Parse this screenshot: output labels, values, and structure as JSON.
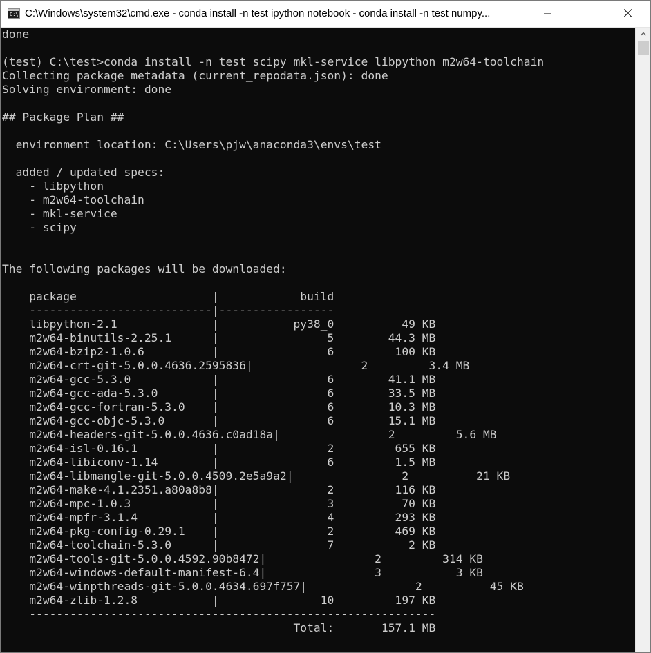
{
  "window": {
    "title": "C:\\Windows\\system32\\cmd.exe - conda  install -n test ipython notebook - conda  install -n test numpy...",
    "icon_text": "C:\\",
    "controls": {
      "minimize": "minimize-icon",
      "maximize": "maximize-icon",
      "close": "close-icon"
    }
  },
  "colors": {
    "console_background": "#0c0c0c",
    "console_text": "#cccccc",
    "titlebar": "#ffffff"
  },
  "console": {
    "lines": [
      "done",
      "",
      "(test) C:\\test>conda install -n test scipy mkl-service libpython m2w64-toolchain",
      "Collecting package metadata (current_repodata.json): done",
      "Solving environment: done",
      "",
      "## Package Plan ##",
      "",
      "  environment location: C:\\Users\\pjw\\anaconda3\\envs\\test",
      "",
      "  added / updated specs:",
      "    - libpython",
      "    - m2w64-toolchain",
      "    - mkl-service",
      "    - scipy",
      "",
      "",
      "The following packages will be downloaded:",
      "",
      "    package                    |            build",
      "    ---------------------------|-----------------",
      "    libpython-2.1              |           py38_0          49 KB",
      "    m2w64-binutils-2.25.1      |                5        44.3 MB",
      "    m2w64-bzip2-1.0.6          |                6         100 KB",
      "    m2w64-crt-git-5.0.0.4636.2595836|                2         3.4 MB",
      "    m2w64-gcc-5.3.0            |                6        41.1 MB",
      "    m2w64-gcc-ada-5.3.0        |                6        33.5 MB",
      "    m2w64-gcc-fortran-5.3.0    |                6        10.3 MB",
      "    m2w64-gcc-objc-5.3.0       |                6        15.1 MB",
      "    m2w64-headers-git-5.0.0.4636.c0ad18a|                2         5.6 MB",
      "    m2w64-isl-0.16.1           |                2         655 KB",
      "    m2w64-libiconv-1.14        |                6         1.5 MB",
      "    m2w64-libmangle-git-5.0.0.4509.2e5a9a2|                2          21 KB",
      "    m2w64-make-4.1.2351.a80a8b8|                2         116 KB",
      "    m2w64-mpc-1.0.3            |                3          70 KB",
      "    m2w64-mpfr-3.1.4           |                4         293 KB",
      "    m2w64-pkg-config-0.29.1    |                2         469 KB",
      "    m2w64-toolchain-5.3.0      |                7           2 KB",
      "    m2w64-tools-git-5.0.0.4592.90b8472|                2         314 KB",
      "    m2w64-windows-default-manifest-6.4|                3           3 KB",
      "    m2w64-winpthreads-git-5.0.0.4634.697f757|                2          45 KB",
      "    m2w64-zlib-1.2.8           |               10         197 KB",
      "    ------------------------------------------------------------",
      "                                           Total:       157.1 MB"
    ]
  }
}
